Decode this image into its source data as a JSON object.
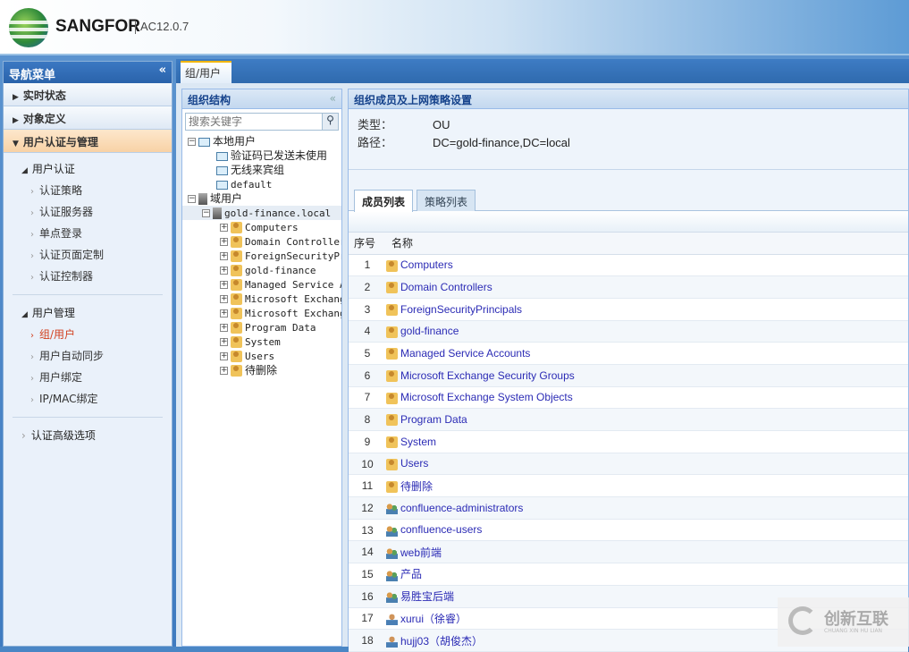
{
  "header": {
    "brand": "SANGFOR",
    "version": "AC12.0.7"
  },
  "nav": {
    "title": "导航菜单",
    "collapse": "«",
    "sections": [
      {
        "label": "实时状态"
      },
      {
        "label": "对象定义"
      },
      {
        "label": "用户认证与管理"
      }
    ],
    "group1": {
      "label": "用户认证",
      "items": [
        "认证策略",
        "认证服务器",
        "单点登录",
        "认证页面定制",
        "认证控制器"
      ]
    },
    "group2": {
      "label": "用户管理",
      "items": [
        "组/用户",
        "用户自动同步",
        "用户绑定",
        "IP/MAC绑定"
      ],
      "active": "组/用户"
    },
    "advanced": "认证高级选项"
  },
  "tab": {
    "label": "组/用户"
  },
  "org": {
    "title": "组织结构",
    "collapse": "«",
    "search_placeholder": "搜索关键字",
    "local": {
      "label": "本地用户",
      "children": [
        "验证码已发送未使用",
        "无线来宾组",
        "default"
      ]
    },
    "domain": {
      "label": "域用户",
      "root": "gold-finance.local",
      "children": [
        "Computers",
        "Domain Controllers",
        "ForeignSecurityPrincipals",
        "gold-finance",
        "Managed Service Accounts",
        "Microsoft Exchange Security Groups",
        "Microsoft Exchange System Objects",
        "Program Data",
        "System",
        "Users",
        "待删除"
      ]
    }
  },
  "detail": {
    "title": "组织成员及上网策略设置",
    "type_label": "类型：",
    "type_value": "OU",
    "path_label": "路径：",
    "path_value": "DC=gold-finance,DC=local",
    "tabs": [
      "成员列表",
      "策略列表"
    ],
    "columns": [
      "序号",
      "名称"
    ],
    "rows": [
      {
        "no": "1",
        "name": "Computers",
        "icon": "ou"
      },
      {
        "no": "2",
        "name": "Domain Controllers",
        "icon": "ou"
      },
      {
        "no": "3",
        "name": "ForeignSecurityPrincipals",
        "icon": "ou"
      },
      {
        "no": "4",
        "name": "gold-finance",
        "icon": "ou"
      },
      {
        "no": "5",
        "name": "Managed Service Accounts",
        "icon": "ou"
      },
      {
        "no": "6",
        "name": "Microsoft Exchange Security Groups",
        "icon": "ou"
      },
      {
        "no": "7",
        "name": "Microsoft Exchange System Objects",
        "icon": "ou"
      },
      {
        "no": "8",
        "name": "Program Data",
        "icon": "ou"
      },
      {
        "no": "9",
        "name": "System",
        "icon": "ou"
      },
      {
        "no": "10",
        "name": "Users",
        "icon": "ou"
      },
      {
        "no": "11",
        "name": "待删除",
        "icon": "ou"
      },
      {
        "no": "12",
        "name": "confluence-administrators",
        "icon": "group"
      },
      {
        "no": "13",
        "name": "confluence-users",
        "icon": "group"
      },
      {
        "no": "14",
        "name": "web前端",
        "icon": "group"
      },
      {
        "no": "15",
        "name": "产品",
        "icon": "group"
      },
      {
        "no": "16",
        "name": "易胜宝后端",
        "icon": "group"
      },
      {
        "no": "17",
        "name": "xurui（徐睿）",
        "icon": "user"
      },
      {
        "no": "18",
        "name": "hujj03（胡俊杰）",
        "icon": "user"
      }
    ]
  },
  "watermark": {
    "text": "创新互联",
    "sub": "CHUANG XIN HU LIAN"
  }
}
